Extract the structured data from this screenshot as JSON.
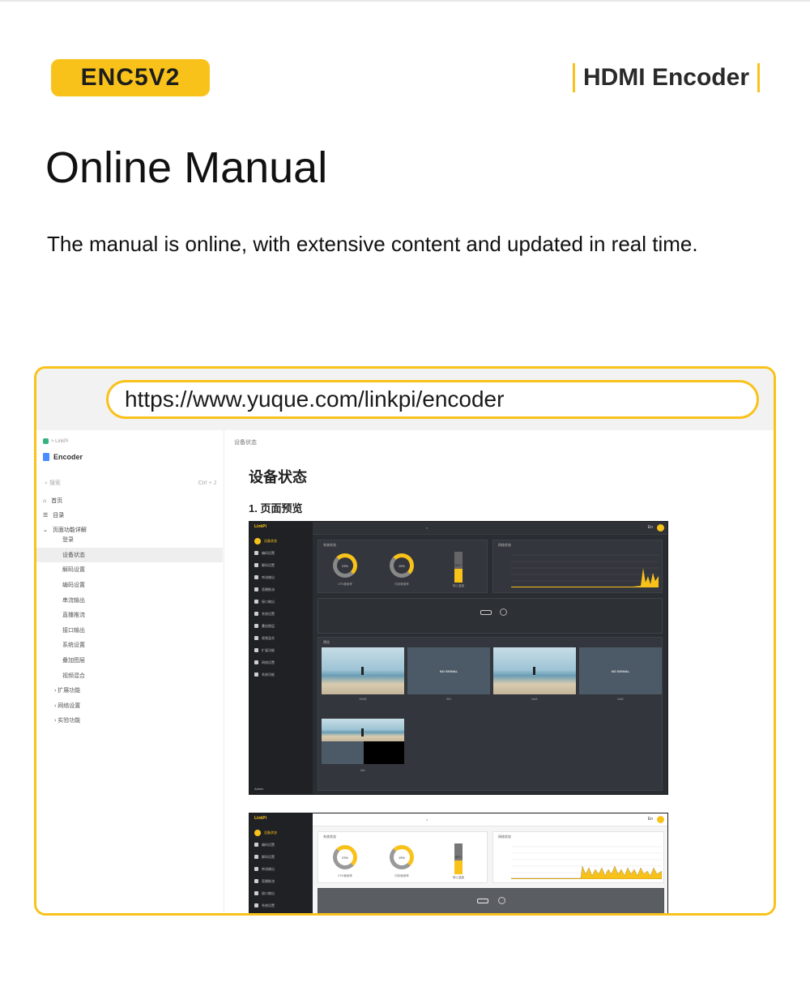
{
  "header": {
    "model": "ENC5V2",
    "product": "HDMI Encoder"
  },
  "title": "Online Manual",
  "subtitle": "The manual is online, with extensive content and updated in real time.",
  "browser": {
    "url": "https://www.yuque.com/linkpi/encoder"
  },
  "doc": {
    "breadcrumb": "> LinkPi",
    "book_title": "Encoder",
    "search_placeholder": "搜索",
    "search_shortcut": "Ctrl + J",
    "nav_home": "首页",
    "nav_toc": "目录",
    "section_group": "页面功能详解",
    "toc": [
      {
        "label": "登录",
        "selected": false,
        "sub": false
      },
      {
        "label": "设备状态",
        "selected": true,
        "sub": false
      },
      {
        "label": "解码设置",
        "selected": false,
        "sub": false
      },
      {
        "label": "编码设置",
        "selected": false,
        "sub": false
      },
      {
        "label": "串流输出",
        "selected": false,
        "sub": false
      },
      {
        "label": "直播推流",
        "selected": false,
        "sub": false
      },
      {
        "label": "接口输出",
        "selected": false,
        "sub": false
      },
      {
        "label": "系统设置",
        "selected": false,
        "sub": false
      },
      {
        "label": "叠加图层",
        "selected": false,
        "sub": false
      },
      {
        "label": "视频混合",
        "selected": false,
        "sub": false
      },
      {
        "label": "› 扩展功能",
        "selected": false,
        "sub": true
      },
      {
        "label": "› 网络设置",
        "selected": false,
        "sub": true
      },
      {
        "label": "› 实验功能",
        "selected": false,
        "sub": true
      }
    ],
    "path": "设备状态",
    "h1": "设备状态",
    "h2": "1. 页面预览"
  },
  "app": {
    "logo": "LinkPi",
    "lang": "En",
    "menu": [
      "设备状态",
      "编码设置",
      "解码设置",
      "串流输出",
      "直播推流",
      "接口输出",
      "系统设置",
      "叠加图层",
      "视频混合",
      "扩展功能",
      "网络设置",
      "系统功能"
    ],
    "cards": {
      "system": "系统状态",
      "network": "网络状态",
      "preview": "预览"
    },
    "rings": [
      {
        "pct": "23%",
        "label": "CPU使用率"
      },
      {
        "pct": "15%",
        "label": "内存使用率"
      }
    ],
    "gauge": {
      "label": "核心温度",
      "value": "50°C",
      "level": 0.45
    },
    "previews": [
      {
        "label": "HDMI",
        "kind": "sea"
      },
      {
        "label": "SDI",
        "kind": "nosig",
        "text": "NO SIGNAL"
      },
      {
        "label": "Net1",
        "kind": "sea"
      },
      {
        "label": "Net2",
        "kind": "nosig",
        "text": "NO SIGNAL"
      }
    ],
    "mix_label": "Mix",
    "admin": "Admin"
  }
}
